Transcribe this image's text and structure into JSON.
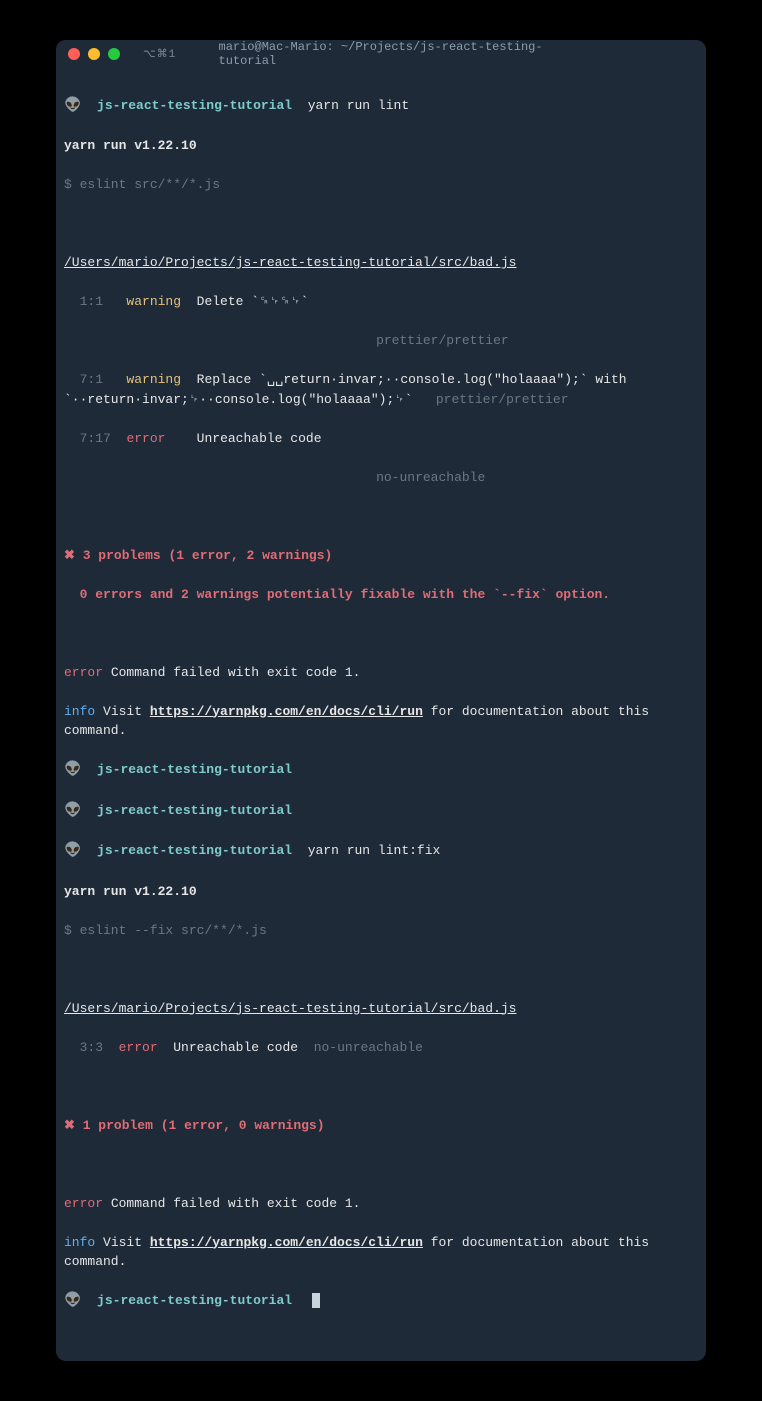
{
  "titlebar": {
    "tab_indicator": "⌥⌘1",
    "title": "mario@Mac-Mario: ~/Projects/js-react-testing-tutorial"
  },
  "colors": {
    "red_light": "#ff5f56",
    "yellow_light": "#ffbd2e",
    "green_light": "#27c93f",
    "background": "#1e2a38",
    "error": "#e06c75",
    "warning": "#e6c07b",
    "info": "#61afef",
    "cwd": "#7ecbcb",
    "dim": "#6b7785"
  },
  "icons": {
    "alien": "👽"
  },
  "block1": {
    "cwd": "js-react-testing-tutorial",
    "cmd": "yarn run lint",
    "yarn_version": "yarn run v1.22.10",
    "eslint_cmd": "$ eslint src/**/*.js",
    "file_path": "/Users/mario/Projects/js-react-testing-tutorial/src/bad.js",
    "issue1_pos": "  1:1",
    "issue1_level": "warning",
    "issue1_msg": "Delete `␍␊␍␊`",
    "issue1_rule": "prettier/prettier",
    "issue2_pos": "  7:1",
    "issue2_level": "warning",
    "issue2_msg": "Replace `␣␣return·invar;··console.log(\"holaaaa\");` with `··return·invar;␊··console.log(\"holaaaa\");␊`",
    "issue2_rule": "prettier/prettier",
    "issue3_pos": "  7:17",
    "issue3_level": "error",
    "issue3_msg": "Unreachable code",
    "issue3_rule": "no-unreachable",
    "summary1": "✖ 3 problems (1 error, 2 warnings)",
    "summary2": "  0 errors and 2 warnings potentially fixable with the `--fix` option.",
    "fail_level": "error",
    "fail_msg": " Command failed with exit code 1.",
    "info_level": "info",
    "info_msg1": " Visit ",
    "info_link": "https://yarnpkg.com/en/docs/cli/run",
    "info_msg2": " for documentation about this command."
  },
  "idle": {
    "cwd1": "js-react-testing-tutorial",
    "cwd2": "js-react-testing-tutorial"
  },
  "block2": {
    "cwd": "js-react-testing-tutorial",
    "cmd": "yarn run lint:fix",
    "yarn_version": "yarn run v1.22.10",
    "eslint_cmd": "$ eslint --fix src/**/*.js",
    "file_path": "/Users/mario/Projects/js-react-testing-tutorial/src/bad.js",
    "issue1_pos": "  3:3",
    "issue1_level": "error",
    "issue1_msg": "Unreachable code",
    "issue1_rule": "no-unreachable",
    "summary1": "✖ 1 problem (1 error, 0 warnings)",
    "fail_level": "error",
    "fail_msg": " Command failed with exit code 1.",
    "info_level": "info",
    "info_msg1": " Visit ",
    "info_link": "https://yarnpkg.com/en/docs/cli/run",
    "info_msg2": " for documentation about this command."
  },
  "prompt": {
    "cwd": "js-react-testing-tutorial"
  }
}
